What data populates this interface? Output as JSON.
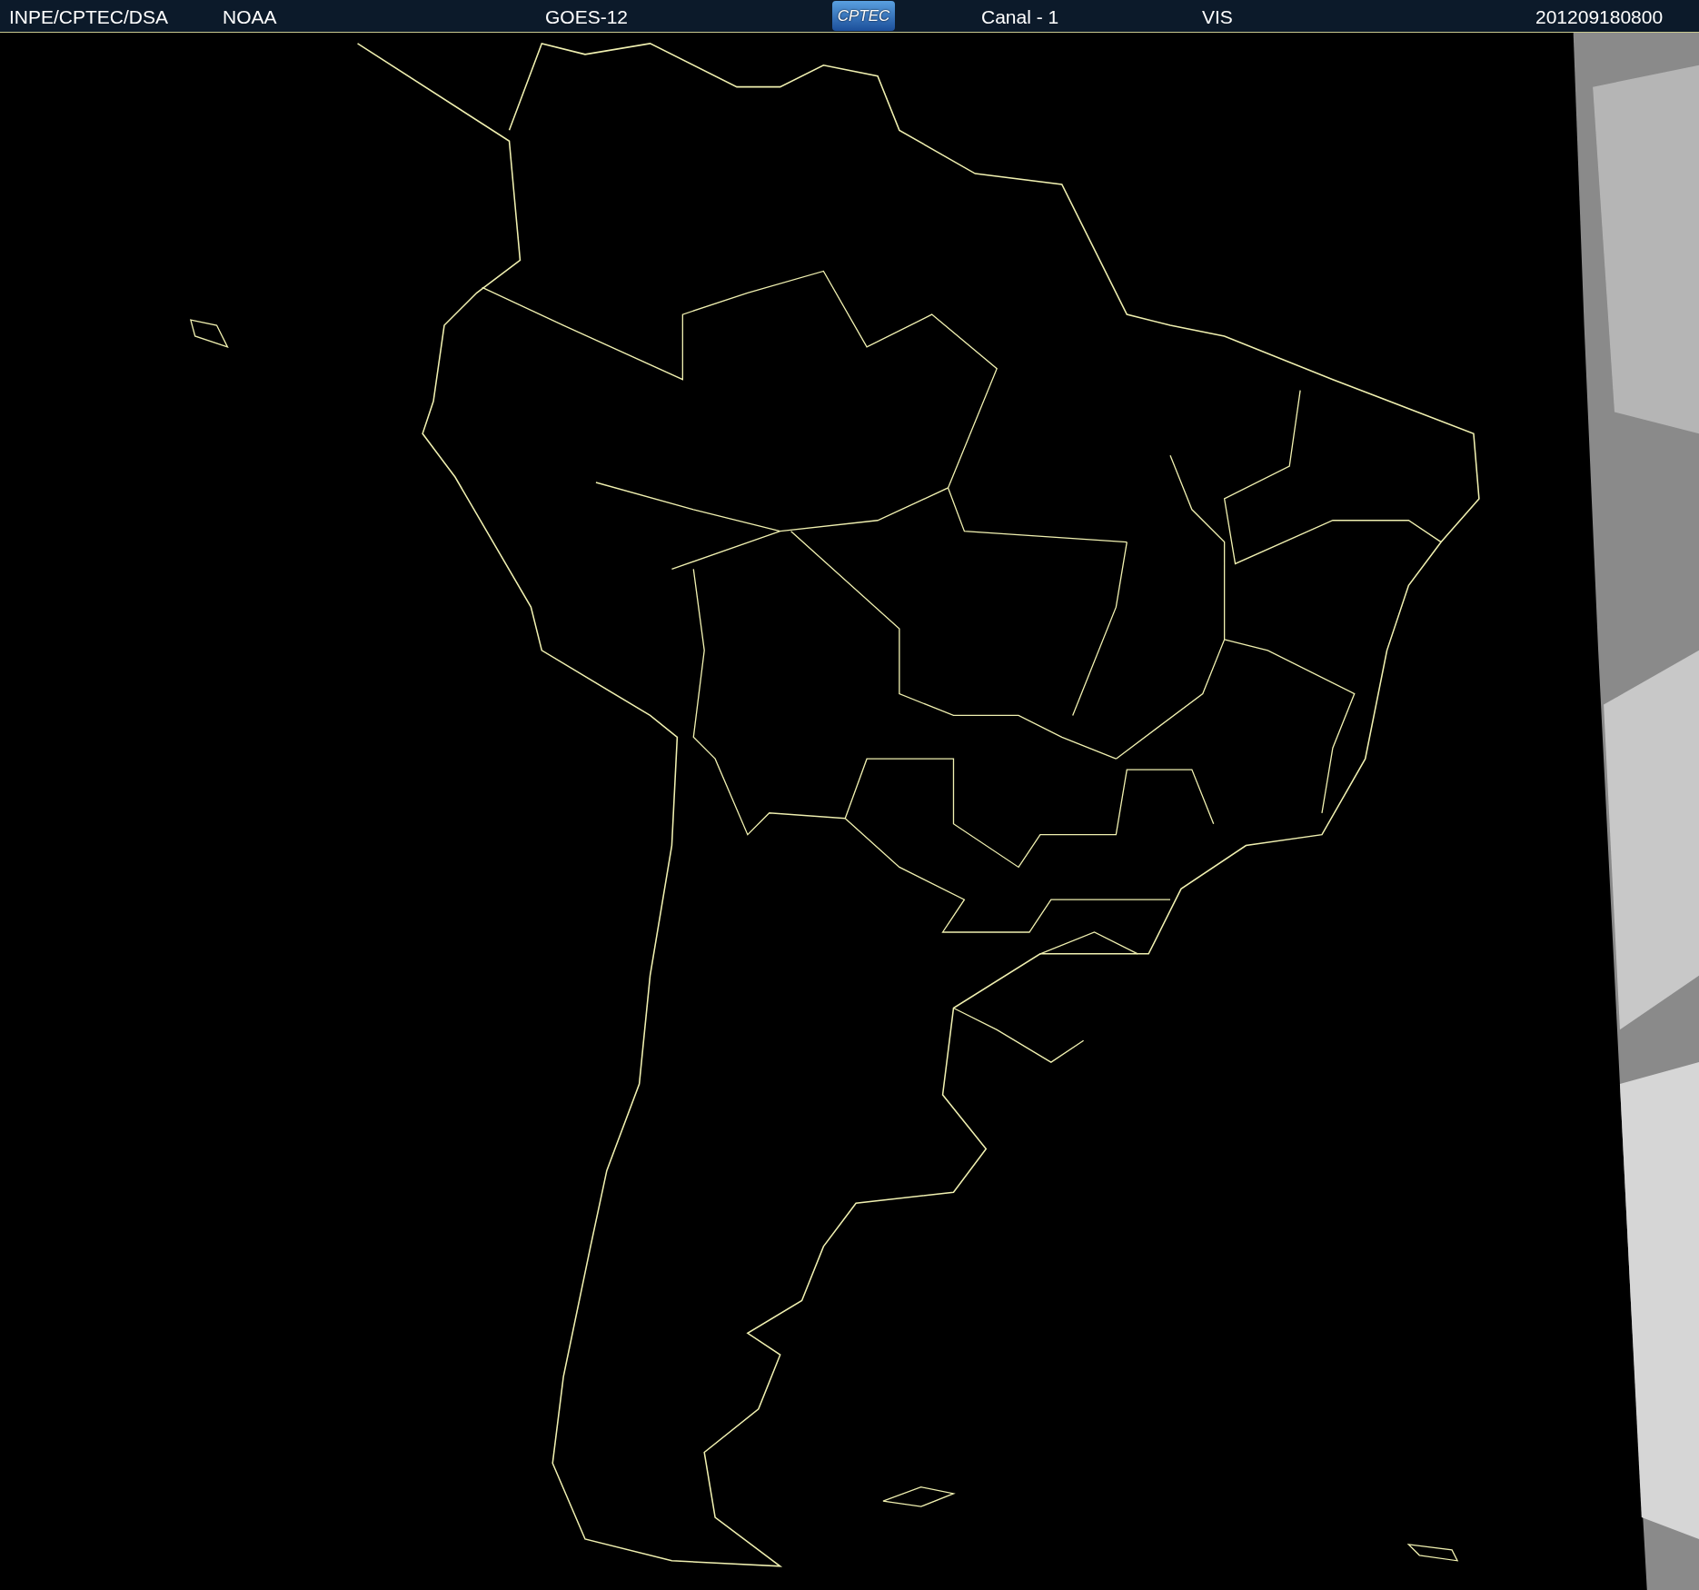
{
  "header": {
    "source": "INPE/CPTEC/DSA",
    "agency": "NOAA",
    "satellite": "GOES-12",
    "logo_text": "CPTEC",
    "channel": "Canal - 1",
    "band": "VIS",
    "timestamp": "201209180800"
  }
}
